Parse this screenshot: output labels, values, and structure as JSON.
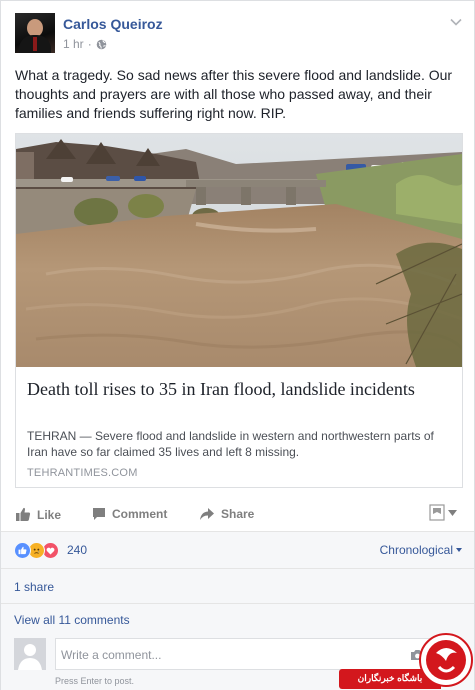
{
  "post": {
    "author": "Carlos Queiroz",
    "time": "1 hr",
    "separator": "·",
    "text": "What a tragedy. So sad news after this severe flood and landslide. Our thoughts and prayers are with all those who passed away, and their families and friends suffering right now. RIP."
  },
  "link": {
    "title": "Death toll rises to 35 in Iran flood, landslide incidents",
    "description": "TEHRAN — Severe flood and landslide in western and northwestern parts of Iran have so far claimed 35 lives and left 8 missing.",
    "source": "TEHRANTIMES.COM"
  },
  "actions": {
    "like": "Like",
    "comment": "Comment",
    "share": "Share"
  },
  "reactions": {
    "count": "240",
    "sort": "Chronological",
    "icons": [
      "like-icon",
      "sad-icon",
      "love-icon"
    ]
  },
  "shares": {
    "label": "1 share"
  },
  "comments": {
    "view_all": "View all 11 comments",
    "placeholder": "Write a comment...",
    "hint": "Press Enter to post."
  },
  "watermark": {
    "text": "باشگاه خبرنگاران"
  },
  "colors": {
    "link_blue": "#365899",
    "like_blue": "#5890ff",
    "love_red": "#f25268",
    "sad_yellow": "#f7b125",
    "badge_red": "#d3171d"
  }
}
